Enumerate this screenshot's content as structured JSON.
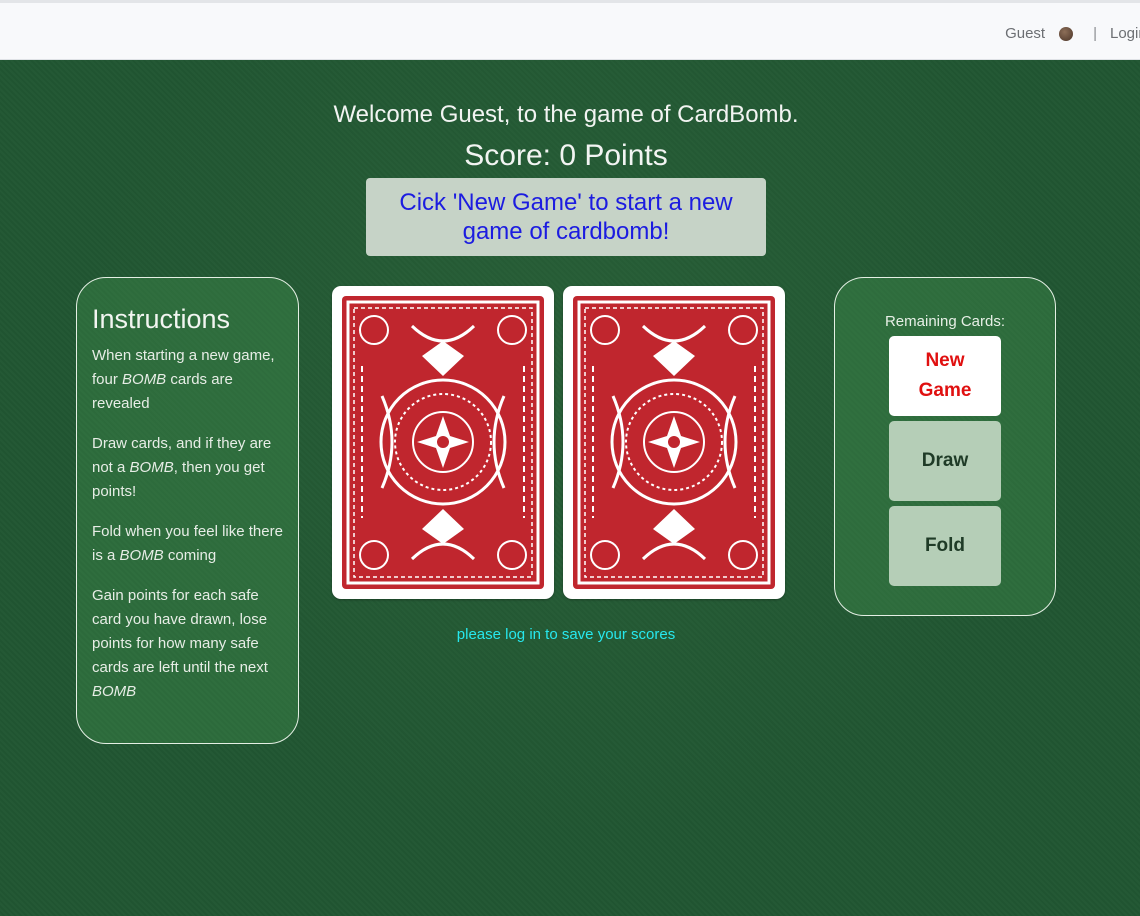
{
  "nav": {
    "user_label": "Guest",
    "separator": "|",
    "login_label": "Login"
  },
  "header": {
    "welcome": "Welcome Guest, to the game of CardBomb.",
    "score": "Score: 0 Points",
    "message": "Cick 'New Game' to start a new game of cardbomb!"
  },
  "instructions": {
    "title": "Instructions",
    "p1_before": "When starting a new game, four ",
    "p1_em": "BOMB",
    "p1_after": " cards are revealed",
    "p2_before": "Draw cards, and if they are not a ",
    "p2_em": "BOMB",
    "p2_after": ", then you get points!",
    "p3_before": "Fold when you feel like there is a ",
    "p3_em": "BOMB",
    "p3_after": " coming",
    "p4_before": "Gain points for each safe card you have drawn, lose points for how many safe cards are left until the next ",
    "p4_em": "BOMB"
  },
  "controls": {
    "remaining_label": "Remaining Cards:",
    "new_game": "New Game",
    "draw": "Draw",
    "fold": "Fold"
  },
  "cards": [
    {
      "face": "back",
      "color": "#c0262e"
    },
    {
      "face": "back",
      "color": "#c0262e"
    }
  ],
  "footer": {
    "save_note": "please log in to save your scores"
  },
  "colors": {
    "felt": "#215632",
    "message_text": "#1c1ce0",
    "new_game_text": "#e01010",
    "save_note": "#26e8ee"
  }
}
